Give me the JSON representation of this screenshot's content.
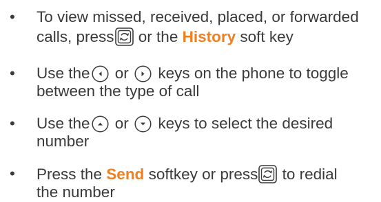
{
  "bullet_symbol": "•",
  "items": [
    {
      "line1_a": "To view missed, received, placed, or forwarded",
      "line2_a": "calls, press",
      "line2_b": " or the ",
      "line2_highlight": "History",
      "line2_c": " soft key",
      "icon": "history-key-icon"
    },
    {
      "line1_a": "Use the",
      "line1_b": " or ",
      "line1_c": " keys on the phone to toggle",
      "line2_a": "between the type of call",
      "icons": [
        "left-arrow-key-icon",
        "right-arrow-key-icon"
      ]
    },
    {
      "line1_a": "Use the",
      "line1_b": " or ",
      "line1_c": " keys to select the desired",
      "line2_a": "number",
      "icons": [
        "up-arrow-key-icon",
        "down-arrow-key-icon"
      ]
    },
    {
      "line1_a": "Press the ",
      "line1_highlight": "Send",
      "line1_b": " softkey or press",
      "line1_c": " to redial",
      "line2_a": "the number",
      "icon": "history-key-icon"
    }
  ],
  "colors": {
    "text": "#3a3a3a",
    "highlight": "#f07f1f"
  }
}
